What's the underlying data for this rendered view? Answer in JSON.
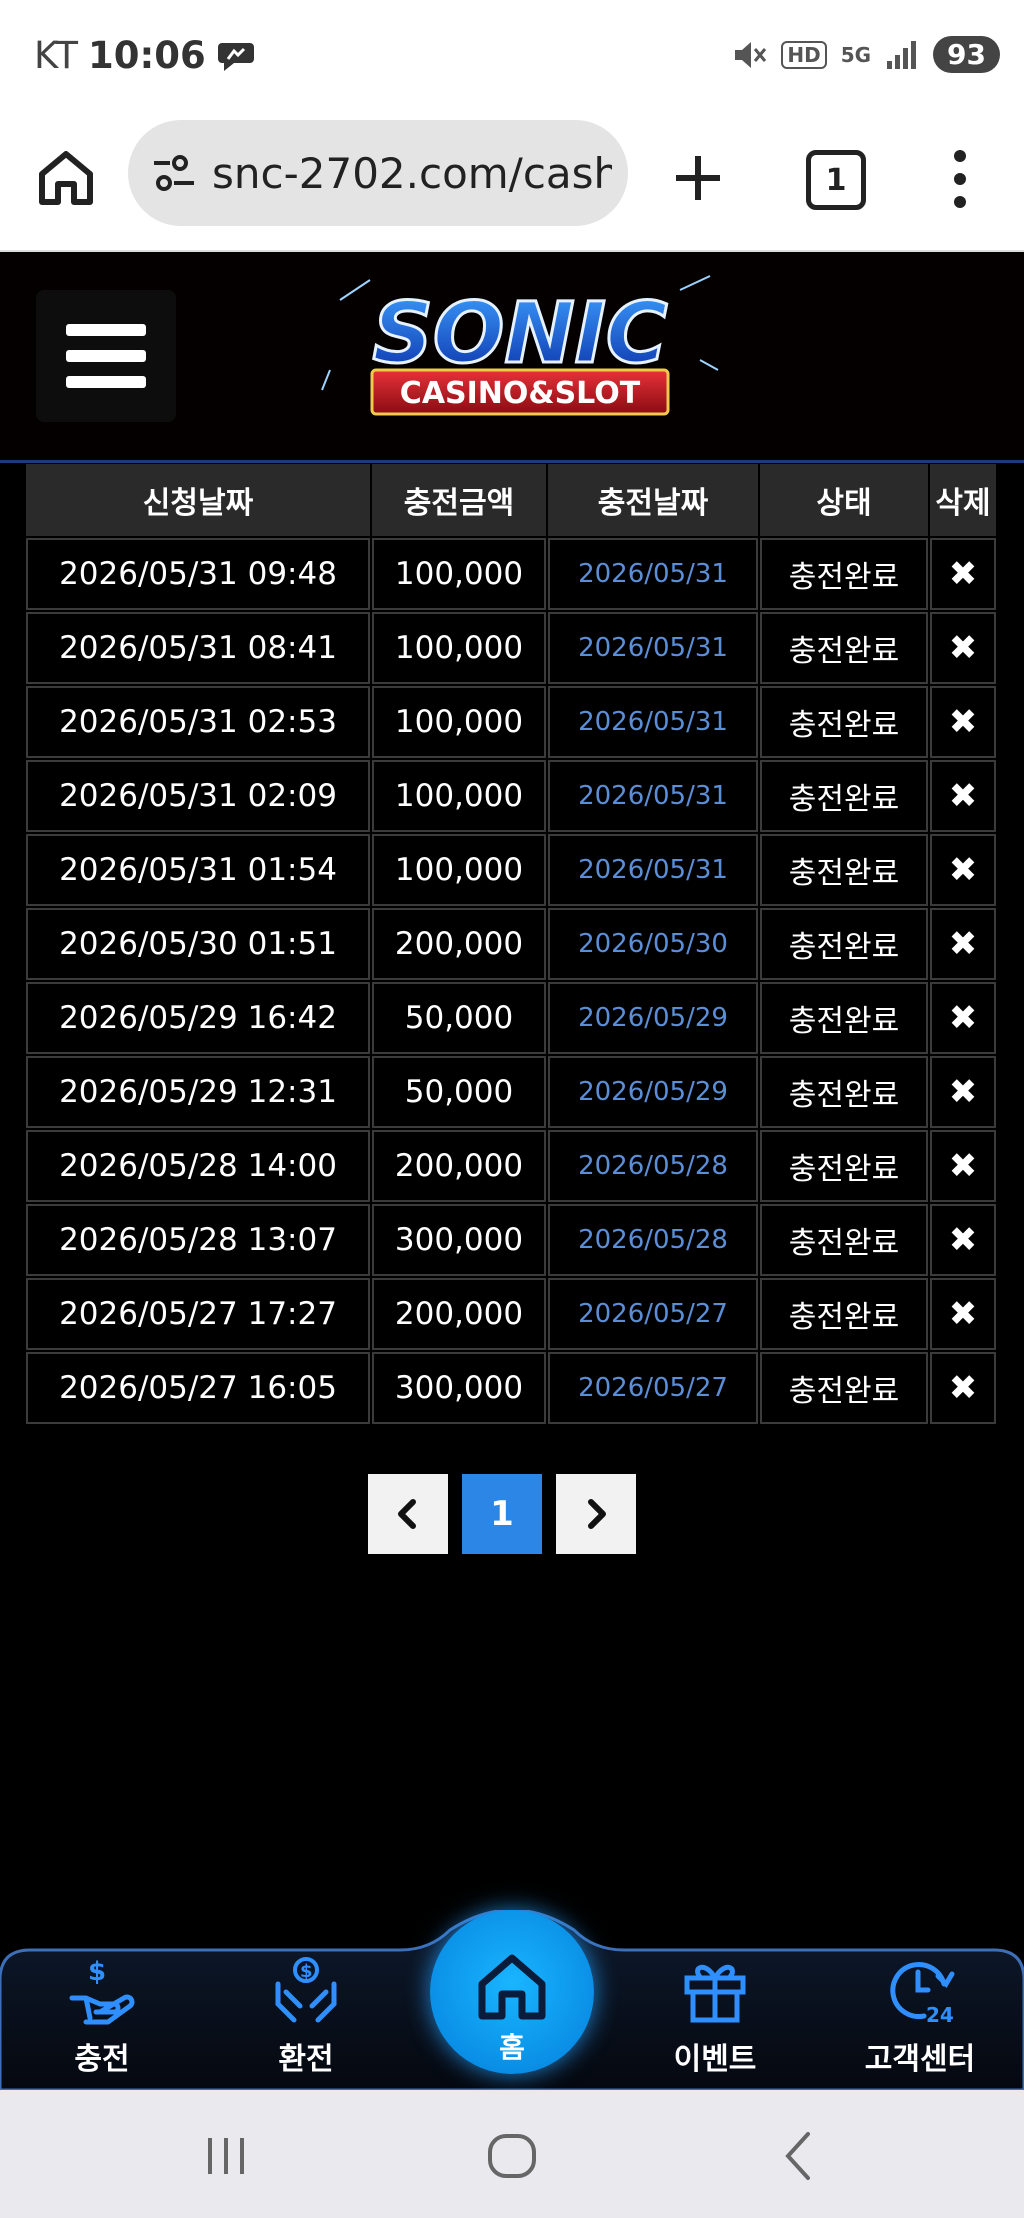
{
  "status_bar": {
    "carrier": "KT",
    "time": "10:06",
    "hd_badge": "HD",
    "network": "5G",
    "battery": "93"
  },
  "browser": {
    "url": "snc-2702.com/cash_",
    "tab_count": "1"
  },
  "header": {
    "logo_top": "SONIC",
    "logo_bottom": "CASINO&SLOT"
  },
  "table": {
    "columns": [
      "신청날짜",
      "충전금액",
      "충전날짜",
      "상태",
      "삭제"
    ],
    "rows": [
      {
        "requested": "2026/05/31 09:48",
        "amount": "100,000",
        "charged": "2026/05/31",
        "status": "충전완료"
      },
      {
        "requested": "2026/05/31 08:41",
        "amount": "100,000",
        "charged": "2026/05/31",
        "status": "충전완료"
      },
      {
        "requested": "2026/05/31 02:53",
        "amount": "100,000",
        "charged": "2026/05/31",
        "status": "충전완료"
      },
      {
        "requested": "2026/05/31 02:09",
        "amount": "100,000",
        "charged": "2026/05/31",
        "status": "충전완료"
      },
      {
        "requested": "2026/05/31 01:54",
        "amount": "100,000",
        "charged": "2026/05/31",
        "status": "충전완료"
      },
      {
        "requested": "2026/05/30 01:51",
        "amount": "200,000",
        "charged": "2026/05/30",
        "status": "충전완료"
      },
      {
        "requested": "2026/05/29 16:42",
        "amount": "50,000",
        "charged": "2026/05/29",
        "status": "충전완료"
      },
      {
        "requested": "2026/05/29 12:31",
        "amount": "50,000",
        "charged": "2026/05/29",
        "status": "충전완료"
      },
      {
        "requested": "2026/05/28 14:00",
        "amount": "200,000",
        "charged": "2026/05/28",
        "status": "충전완료"
      },
      {
        "requested": "2026/05/28 13:07",
        "amount": "300,000",
        "charged": "2026/05/28",
        "status": "충전완료"
      },
      {
        "requested": "2026/05/27 17:27",
        "amount": "200,000",
        "charged": "2026/05/27",
        "status": "충전완료"
      },
      {
        "requested": "2026/05/27 16:05",
        "amount": "300,000",
        "charged": "2026/05/27",
        "status": "충전완료"
      }
    ],
    "delete_glyph": "✖"
  },
  "pagination": {
    "prev_icon": "chevron-left-icon",
    "current": "1",
    "next_icon": "chevron-right-icon"
  },
  "bottom_nav": {
    "deposit": "충전",
    "withdraw": "환전",
    "home": "홈",
    "event": "이벤트",
    "support": "고객센터",
    "support_badge": "24"
  },
  "colors": {
    "accent_blue": "#2b86e6",
    "date_link": "#5b8ed6",
    "nav_icon": "#2f8fff"
  }
}
